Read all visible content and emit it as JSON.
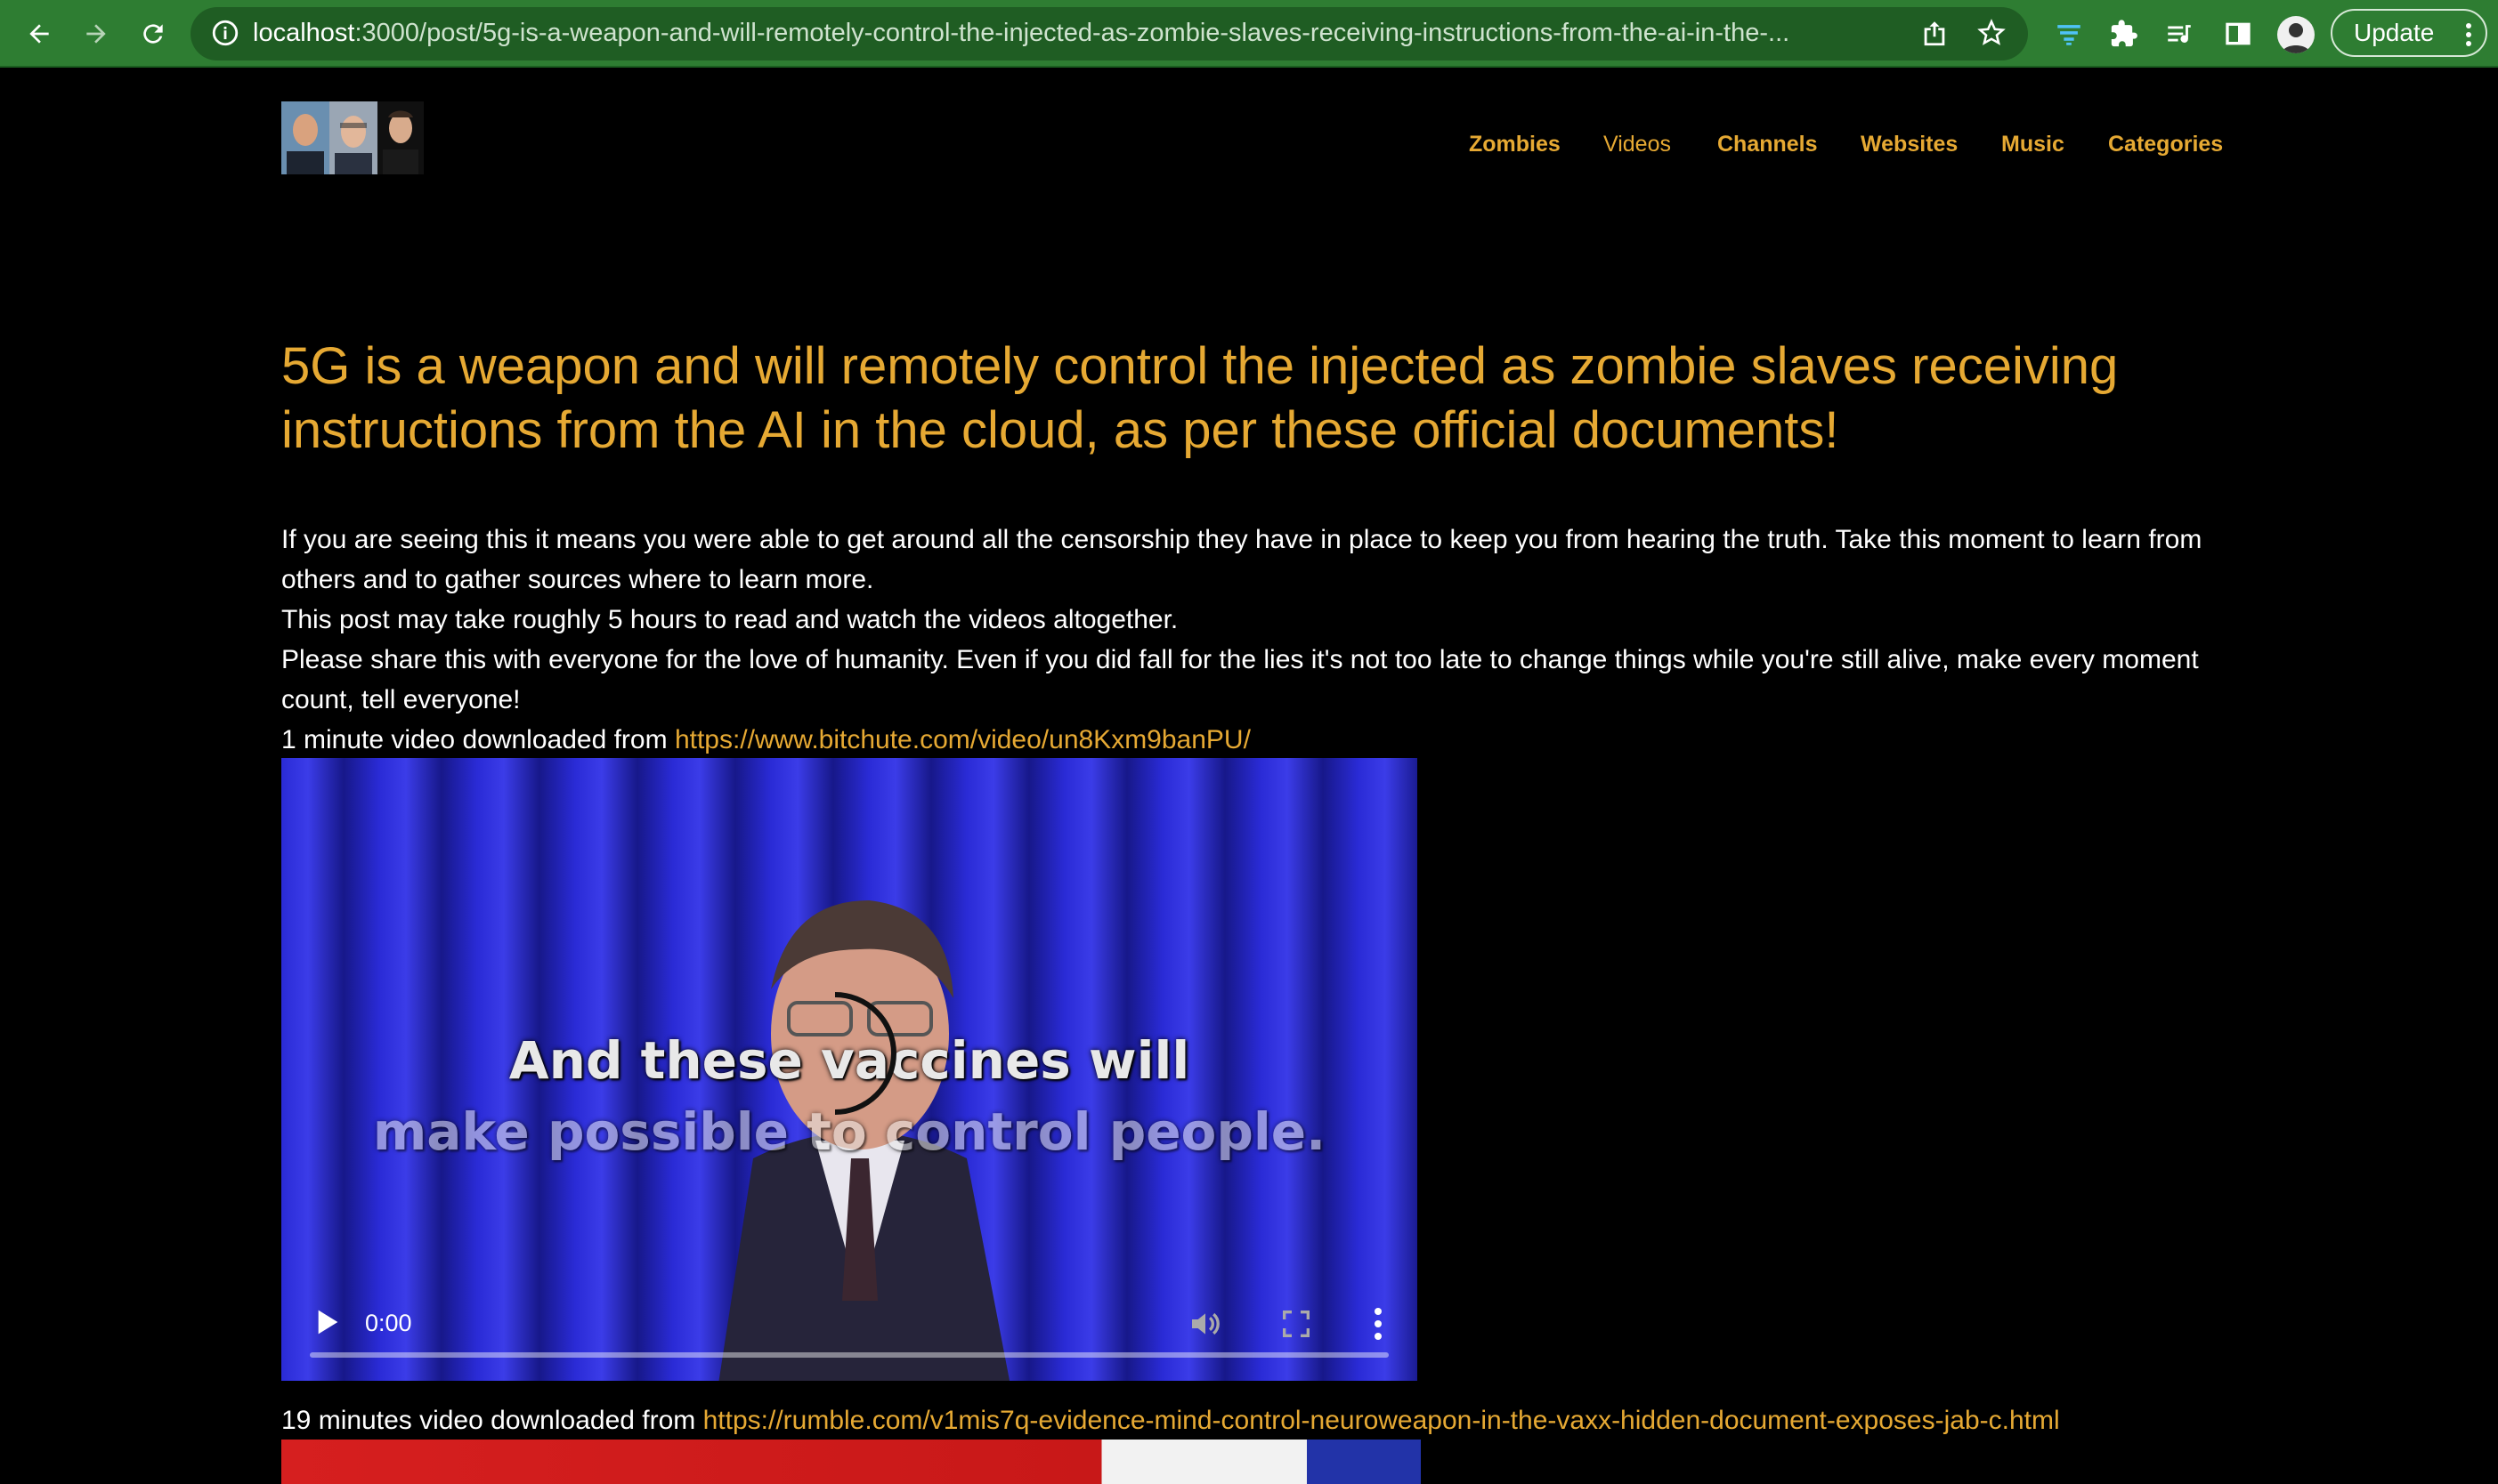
{
  "browser": {
    "url_host": "localhost",
    "url_rest": ":3000/post/5g-is-a-weapon-and-will-remotely-control-the-injected-as-zombie-slaves-receiving-instructions-from-the-ai-in-the-...",
    "update_label": "Update",
    "accent_color": "#2e7d32"
  },
  "nav": {
    "items": [
      {
        "label": "Zombies"
      },
      {
        "label": "Videos"
      },
      {
        "label": "Channels"
      },
      {
        "label": "Websites"
      },
      {
        "label": "Music"
      },
      {
        "label": "Categories"
      }
    ]
  },
  "post": {
    "title": "5G is a weapon and will remotely control the injected as zombie slaves receiving instructions from the AI in the cloud, as per these official documents!",
    "intro": "If you are seeing this it means you were able to get around all the censorship they have in place to keep you from hearing the truth. Take this moment to learn from others and to gather sources where to learn more.",
    "read_time": "This post may take roughly 5 hours to read and watch the videos altogether.",
    "share": "Please share this with everyone for the love of humanity. Even if you did fall for the lies it's not too late to change things while you're still alive, make every moment count, tell everyone!",
    "video1_prefix": "1 minute video downloaded from ",
    "video1_link": "https://www.bitchute.com/video/un8Kxm9banPU/",
    "video1_subtitle_line1": "And these vaccines will",
    "video1_subtitle_line2": "make possible to control people.",
    "video1_time": "0:00",
    "video1_progress": 0,
    "video2_prefix": "19 minutes video downloaded from ",
    "video2_link": "https://rumble.com/v1mis7q-evidence-mind-control-neuroweapon-in-the-vaxx-hidden-document-exposes-jab-c.html"
  },
  "colors": {
    "link": "#e6a933",
    "text": "#ffffff",
    "background": "#000000"
  },
  "icons": [
    "back-icon",
    "forward-icon",
    "reload-icon",
    "info-icon",
    "share-icon",
    "star-icon",
    "extension-icon",
    "puzzle-icon",
    "reading-list-icon",
    "sidebar-icon",
    "more-vert-icon",
    "play-icon",
    "volume-icon",
    "fullscreen-icon",
    "video-more-icon",
    "loading-spinner-icon"
  ]
}
